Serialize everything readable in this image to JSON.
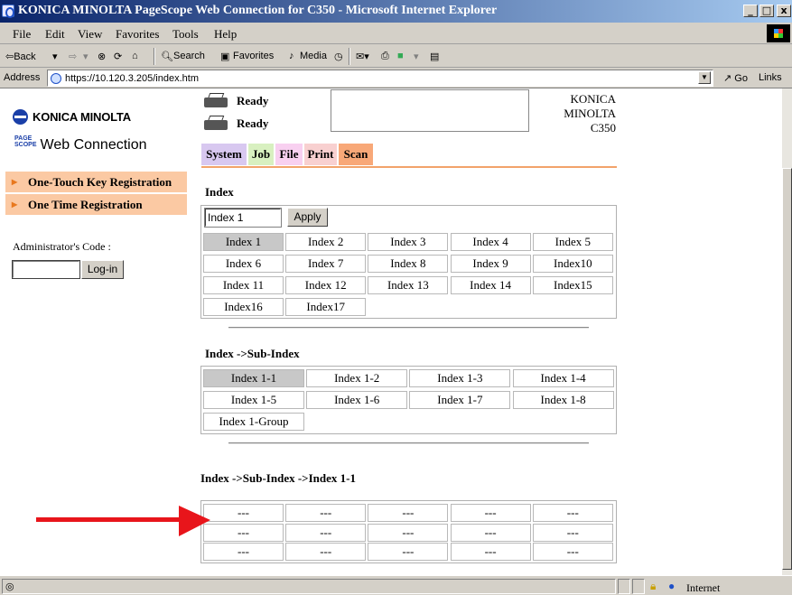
{
  "window": {
    "title": "KONICA MINOLTA PageScope Web Connection for C350 - Microsoft Internet Explorer",
    "minimize": "_",
    "maximize": "□",
    "close": "x"
  },
  "menu": [
    "File",
    "Edit",
    "View",
    "Favorites",
    "Tools",
    "Help"
  ],
  "toolbar": {
    "back": "⇦Back",
    "search": "Search",
    "favorites": "Favorites",
    "media": "Media"
  },
  "address": {
    "label": "Address",
    "url": "https://10.120.3.205/index.htm",
    "go": "Go",
    "links": "Links"
  },
  "sidebar": {
    "brand": "KONICA MINOLTA",
    "badge_line1": "PAGE",
    "badge_line2": "SCOPE",
    "product": "Web Connection",
    "items": [
      "One-Touch Key Registration",
      "One Time Registration"
    ],
    "admin_label": "Administrator's Code :",
    "login_label": "Log-in"
  },
  "status": {
    "printer_status": "Ready",
    "scanner_status": "Ready",
    "model_lines": [
      "KONICA",
      "MINOLTA",
      "C350"
    ]
  },
  "tabs": [
    {
      "label": "System",
      "color": "#d8c8f0"
    },
    {
      "label": "Job",
      "color": "#d8f0c0"
    },
    {
      "label": "File",
      "color": "#f8d0f0"
    },
    {
      "label": "Print",
      "color": "#f8d0d0"
    },
    {
      "label": "Scan",
      "color": "#f8a878"
    }
  ],
  "index_section": {
    "title": "Index",
    "input_value": "Index 1",
    "apply_label": "Apply",
    "rows": [
      [
        "Index 1",
        "Index 2",
        "Index 3",
        "Index 4",
        "Index 5"
      ],
      [
        "Index 6",
        "Index 7",
        "Index 8",
        "Index 9",
        "Index10"
      ],
      [
        "Index 11",
        "Index 12",
        "Index 13",
        "Index 14",
        "Index15"
      ],
      [
        "Index16",
        "Index17"
      ]
    ]
  },
  "subindex_section": {
    "title": "Index ->Sub-Index",
    "rows": [
      [
        "Index 1-1",
        "Index 1-2",
        "Index 1-3",
        "Index 1-4"
      ],
      [
        "Index 1-5",
        "Index 1-6",
        "Index 1-7",
        "Index 1-8"
      ],
      [
        "Index 1-Group"
      ]
    ]
  },
  "entries_section": {
    "title": "Index ->Sub-Index ->Index 1-1",
    "rows": [
      [
        "---",
        "---",
        "---",
        "---",
        "---"
      ],
      [
        "---",
        "---",
        "---",
        "---",
        "---"
      ],
      [
        "---",
        "---",
        "---",
        "---",
        "---"
      ]
    ]
  },
  "statusbar": {
    "zone": "Internet"
  },
  "annotation": {
    "arrow_color": "#e8151b"
  }
}
